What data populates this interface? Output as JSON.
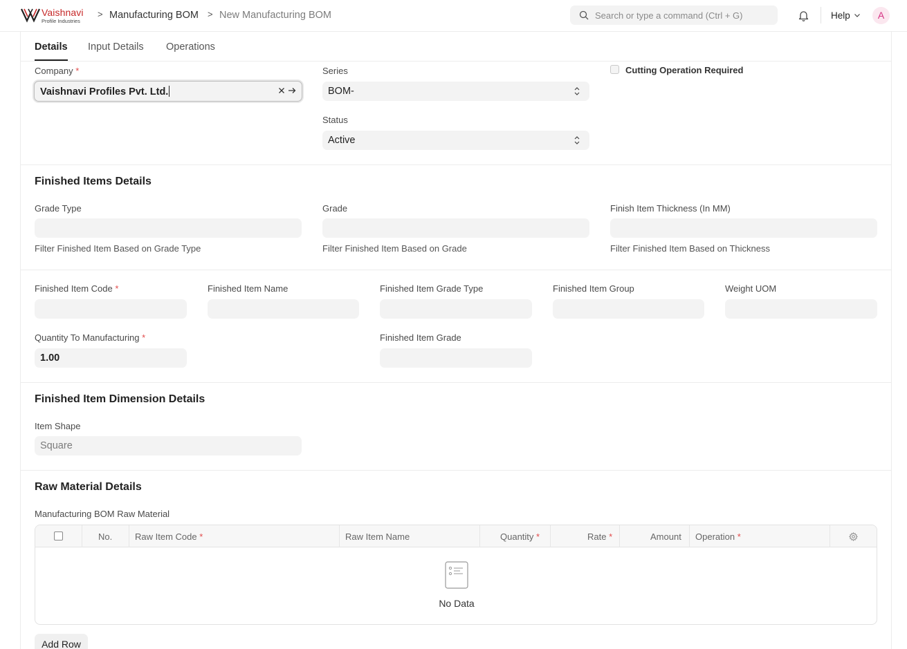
{
  "brand": {
    "name": "Vaishnavi",
    "subtitle": "Profile Industries",
    "accent": "#c62828"
  },
  "breadcrumb": {
    "parent": "Manufacturing BOM",
    "current": "New Manufacturing BOM",
    "separator": ">"
  },
  "search": {
    "placeholder": "Search or type a command (Ctrl + G)"
  },
  "nav": {
    "help": "Help",
    "avatar_initial": "A"
  },
  "tabs": [
    {
      "label": "Details",
      "active": true
    },
    {
      "label": "Input Details",
      "active": false
    },
    {
      "label": "Operations",
      "active": false
    }
  ],
  "header_form": {
    "company": {
      "label": "Company",
      "value": "Vaishnavi Profiles Pvt. Ltd.",
      "required": true
    },
    "series": {
      "label": "Series",
      "value": "BOM-"
    },
    "status": {
      "label": "Status",
      "value": "Active"
    },
    "cutting": {
      "label": "Cutting Operation Required",
      "checked": false
    }
  },
  "finished_items": {
    "title": "Finished Items Details",
    "grade_type": {
      "label": "Grade Type",
      "value": "",
      "help": "Filter Finished Item Based on Grade Type"
    },
    "grade": {
      "label": "Grade",
      "value": "",
      "help": "Filter Finished Item Based on Grade"
    },
    "thickness": {
      "label": "Finish Item Thickness (In MM)",
      "value": "",
      "help": "Filter Finished Item Based on Thickness"
    }
  },
  "finished_item": {
    "code": {
      "label": "Finished Item Code",
      "value": "",
      "required": true
    },
    "name": {
      "label": "Finished Item Name",
      "value": ""
    },
    "grade_type": {
      "label": "Finished Item Grade Type",
      "value": ""
    },
    "group": {
      "label": "Finished Item Group",
      "value": ""
    },
    "weight_uom": {
      "label": "Weight UOM",
      "value": ""
    },
    "quantity": {
      "label": "Quantity To Manufacturing",
      "value": "1.00",
      "required": true
    },
    "grade": {
      "label": "Finished Item Grade",
      "value": ""
    }
  },
  "dimension": {
    "title": "Finished Item Dimension Details",
    "shape": {
      "label": "Item Shape",
      "placeholder": "Square"
    }
  },
  "raw_material": {
    "title": "Raw Material Details",
    "table_label": "Manufacturing BOM Raw Material",
    "columns": [
      "No.",
      "Raw Item Code",
      "Raw Item Name",
      "Quantity",
      "Rate",
      "Amount",
      "Operation"
    ],
    "empty_text": "No Data",
    "add_row": "Add Row"
  },
  "required_mark": "*"
}
